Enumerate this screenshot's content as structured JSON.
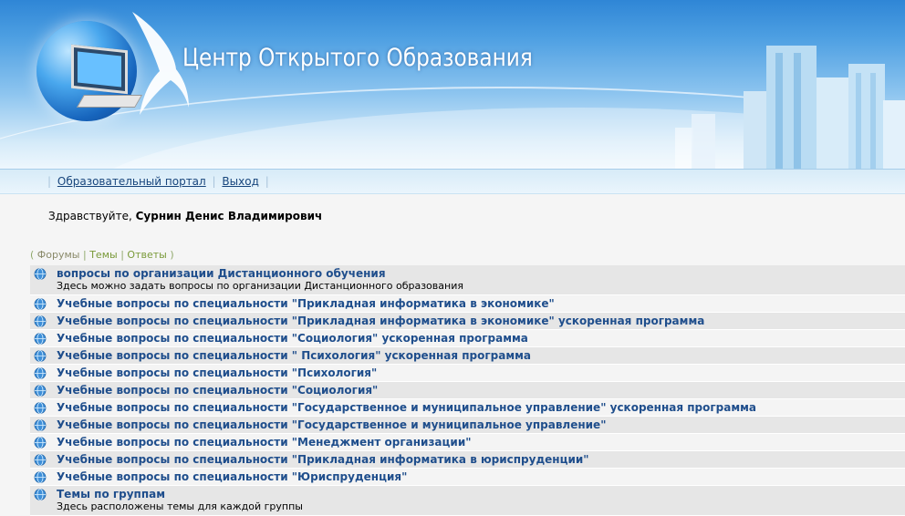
{
  "site": {
    "title": "Центр Открытого Образования"
  },
  "nav": {
    "portal_link": "Образовательный портал",
    "logout_link": "Выход",
    "sep": "|"
  },
  "greeting": {
    "prefix": "Здравствуйте,",
    "user_name": "Сурнин Денис Владимирович"
  },
  "tabs": {
    "open_paren": "(",
    "forums": "Форумы",
    "topics": "Темы",
    "answers": "Ответы",
    "close_paren": ")",
    "sep": "|"
  },
  "forums": [
    {
      "title": "вопросы по организации Дистанционного обучения",
      "desc": "Здесь можно задать вопросы по организации Дистанционного образования"
    },
    {
      "title": "Учебные вопросы по специальности \"Прикладная информатика в экономике\""
    },
    {
      "title": "Учебные вопросы по специальности \"Прикладная информатика в экономике\" ускоренная программа"
    },
    {
      "title": "Учебные вопросы по специальности \"Социология\" ускоренная программа"
    },
    {
      "title": "Учебные вопросы по специальности \" Психология\" ускоренная программа"
    },
    {
      "title": "Учебные вопросы по специальности \"Психология\""
    },
    {
      "title": "Учебные вопросы по специальности \"Социология\""
    },
    {
      "title": "Учебные вопросы по специальности \"Государственное и муниципальное управление\" ускоренная программа"
    },
    {
      "title": "Учебные вопросы по специальности \"Государственное и муниципальное управление\""
    },
    {
      "title": "Учебные вопросы по специальности \"Менеджмент организации\""
    },
    {
      "title": "Учебные вопросы по специальности \"Прикладная информатика в юриспруденции\""
    },
    {
      "title": "Учебные вопросы по специальности \"Юриспруденция\""
    },
    {
      "title": "Темы по группам",
      "desc": "Здесь расположены темы для каждой группы"
    }
  ]
}
